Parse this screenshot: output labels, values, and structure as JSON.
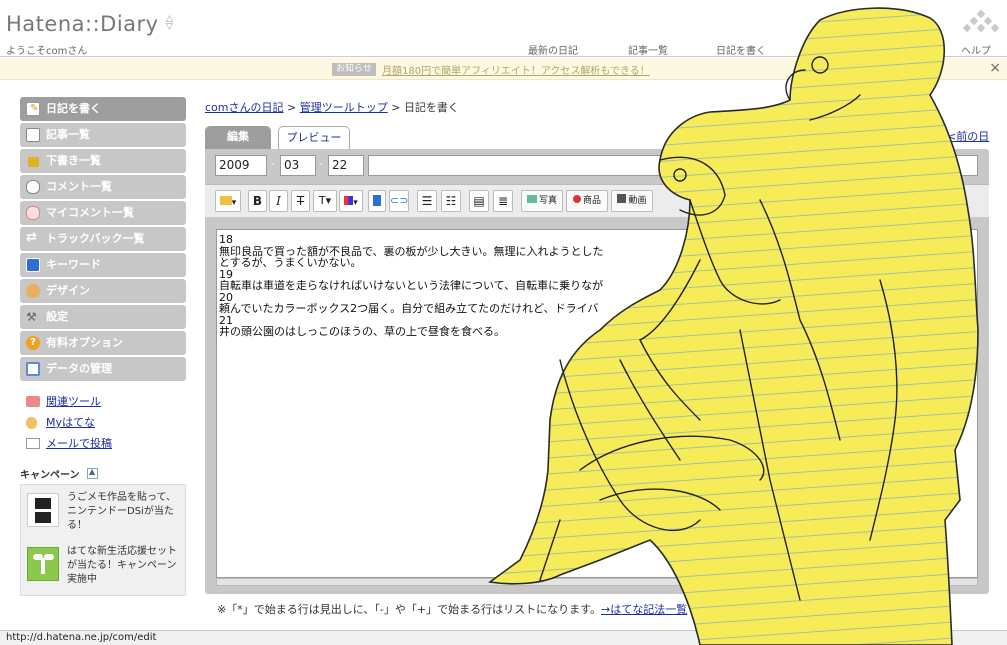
{
  "header": {
    "logo_text": "Hatena::Diary",
    "welcome": "ようこそcomさん",
    "nav": [
      "最新の日記",
      "記事一覧",
      "日記を書く",
      "ヘルプ"
    ]
  },
  "notice": {
    "badge": "お知らせ",
    "text": "月額180円で簡単アフィリエイト！アクセス解析もできる！",
    "close": "×"
  },
  "sidebar": {
    "items": [
      {
        "label": "日記を書く",
        "icon": "pencil-icon",
        "color": "#f5c518"
      },
      {
        "label": "記事一覧",
        "icon": "document-icon",
        "color": "#ffffff"
      },
      {
        "label": "下書き一覧",
        "icon": "lock-icon",
        "color": "#d9a400"
      },
      {
        "label": "コメント一覧",
        "icon": "comment-icon",
        "color": "#ffffff"
      },
      {
        "label": "マイコメント一覧",
        "icon": "my-comment-icon",
        "color": "#f4a0a0"
      },
      {
        "label": "トラックバック一覧",
        "icon": "trackback-icon",
        "color": "#7fa6e8"
      },
      {
        "label": "キーワード",
        "icon": "keyword-icon",
        "color": "#2d6fd6"
      },
      {
        "label": "デザイン",
        "icon": "palette-icon",
        "color": "#e8b060"
      },
      {
        "label": "設定",
        "icon": "wrench-icon",
        "color": "#9aa0a8"
      },
      {
        "label": "有料オプション",
        "icon": "question-icon",
        "color": "#f0a020"
      },
      {
        "label": "データの管理",
        "icon": "table-icon",
        "color": "#5a8ad8"
      }
    ],
    "links": [
      {
        "label": "関連ツール",
        "icon": "toolbox-icon"
      },
      {
        "label": "Myはてな",
        "icon": "user-icon"
      },
      {
        "label": "メールで投稿",
        "icon": "mail-icon"
      }
    ],
    "campaign_title": "キャンペーン",
    "campaigns": [
      {
        "text": "うごメモ作品を貼って、ニンテンドーDSiが当たる！",
        "icon": "nintendo-dsi-icon"
      },
      {
        "text": "はてな新生活応援セットが当たる！キャンペーン実施中",
        "icon": "sprout-icon"
      }
    ]
  },
  "breadcrumb": {
    "link1": "comさんの日記",
    "link2": "管理ツールトップ",
    "current": "日記を書く",
    "sep": ">"
  },
  "tabs": {
    "edit": "編集",
    "preview": "プレビュー",
    "prev_day": "<前の日"
  },
  "date": {
    "year": "2009",
    "month": "03",
    "day": "22",
    "sep": "-"
  },
  "toolbar": {
    "bold": "B",
    "italic": "I",
    "photo": "写真",
    "product": "商品",
    "video": "動画"
  },
  "editor": {
    "lines": [
      "18",
      "無印良品で買った額が不良品で、裏の板が少し大きい。無理に入れようとした",
      "とするが、うまくいかない。",
      "19",
      "自転車は車道を走らなければいけないという法律について、自転車に乗りなが",
      "20",
      "頼んでいたカラーボックス2つ届く。自分で組み立てたのだけれど、ドライバ",
      "21",
      "井の頭公園のはしっこのほうの、草の上で昼食を食べる。"
    ]
  },
  "note": {
    "text": "※「*」で始まる行は見出しに、「-」や「+」で始まる行はリストになります。",
    "link": "→はてな記法一覧"
  },
  "status_bar": "http://d.hatena.ne.jp/com/edit"
}
